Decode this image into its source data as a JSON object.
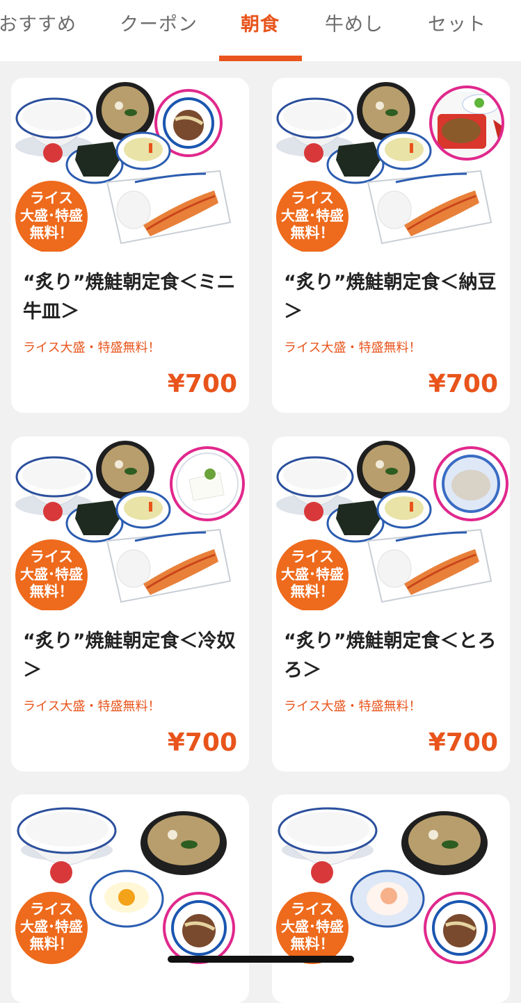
{
  "tabs": [
    {
      "label": "おすすめ"
    },
    {
      "label": "クーポン"
    },
    {
      "label": "朝食"
    },
    {
      "label": "牛めし"
    },
    {
      "label": "セット"
    }
  ],
  "colors": {
    "accent": "#e8541b",
    "highlight_ring": "#e0288c",
    "badge": "#ee6a1c"
  },
  "items": [
    {
      "name": "“炙り”焼鮭朝定食＜ミニ牛皿＞",
      "promo": "ライス大盛・特盛無料！",
      "price": "¥700",
      "badge": [
        "ライス",
        "大盛･特盛",
        "無料！"
      ],
      "side": "mini-gyudon-icon"
    },
    {
      "name": "“炙り”焼鮭朝定食＜納豆＞",
      "promo": "ライス大盛・特盛無料！",
      "price": "¥700",
      "badge": [
        "ライス",
        "大盛･特盛",
        "無料！"
      ],
      "side": "natto-icon"
    },
    {
      "name": "“炙り”焼鮭朝定食＜冷奴＞",
      "promo": "ライス大盛・特盛無料！",
      "price": "¥700",
      "badge": [
        "ライス",
        "大盛･特盛",
        "無料！"
      ],
      "side": "hiyayakko-icon"
    },
    {
      "name": "“炙り”焼鮭朝定食＜とろろ＞",
      "promo": "ライス大盛・特盛無料！",
      "price": "¥700",
      "badge": [
        "ライス",
        "大盛･特盛",
        "無料！"
      ],
      "side": "tororo-icon"
    },
    {
      "badge": [
        "ライス",
        "大盛･特盛",
        "無料！"
      ],
      "side": "mini-gyudon-icon"
    },
    {
      "badge": [
        "ライス",
        "大盛･特盛",
        "無料！"
      ],
      "side": "mini-gyudon-icon"
    }
  ]
}
